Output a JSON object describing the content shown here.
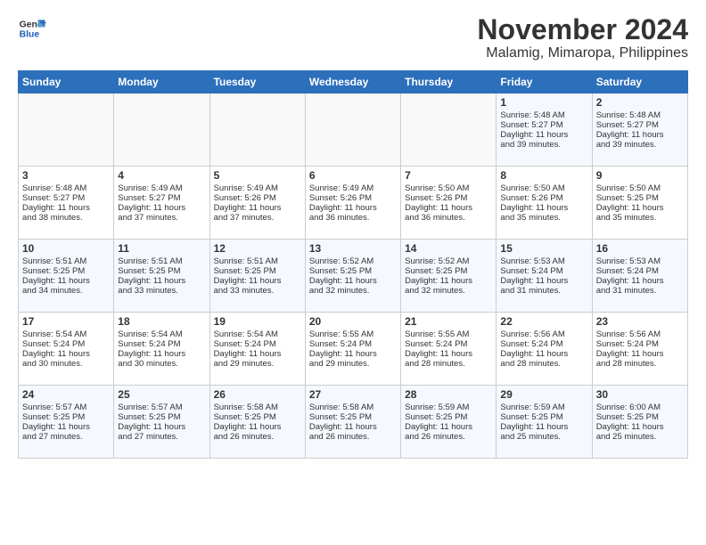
{
  "logo": {
    "line1": "General",
    "line2": "Blue"
  },
  "header": {
    "month": "November 2024",
    "location": "Malamig, Mimaropa, Philippines"
  },
  "weekdays": [
    "Sunday",
    "Monday",
    "Tuesday",
    "Wednesday",
    "Thursday",
    "Friday",
    "Saturday"
  ],
  "weeks": [
    [
      {
        "day": "",
        "info": ""
      },
      {
        "day": "",
        "info": ""
      },
      {
        "day": "",
        "info": ""
      },
      {
        "day": "",
        "info": ""
      },
      {
        "day": "",
        "info": ""
      },
      {
        "day": "1",
        "info": "Sunrise: 5:48 AM\nSunset: 5:27 PM\nDaylight: 11 hours\nand 39 minutes."
      },
      {
        "day": "2",
        "info": "Sunrise: 5:48 AM\nSunset: 5:27 PM\nDaylight: 11 hours\nand 39 minutes."
      }
    ],
    [
      {
        "day": "3",
        "info": "Sunrise: 5:48 AM\nSunset: 5:27 PM\nDaylight: 11 hours\nand 38 minutes."
      },
      {
        "day": "4",
        "info": "Sunrise: 5:49 AM\nSunset: 5:27 PM\nDaylight: 11 hours\nand 37 minutes."
      },
      {
        "day": "5",
        "info": "Sunrise: 5:49 AM\nSunset: 5:26 PM\nDaylight: 11 hours\nand 37 minutes."
      },
      {
        "day": "6",
        "info": "Sunrise: 5:49 AM\nSunset: 5:26 PM\nDaylight: 11 hours\nand 36 minutes."
      },
      {
        "day": "7",
        "info": "Sunrise: 5:50 AM\nSunset: 5:26 PM\nDaylight: 11 hours\nand 36 minutes."
      },
      {
        "day": "8",
        "info": "Sunrise: 5:50 AM\nSunset: 5:26 PM\nDaylight: 11 hours\nand 35 minutes."
      },
      {
        "day": "9",
        "info": "Sunrise: 5:50 AM\nSunset: 5:25 PM\nDaylight: 11 hours\nand 35 minutes."
      }
    ],
    [
      {
        "day": "10",
        "info": "Sunrise: 5:51 AM\nSunset: 5:25 PM\nDaylight: 11 hours\nand 34 minutes."
      },
      {
        "day": "11",
        "info": "Sunrise: 5:51 AM\nSunset: 5:25 PM\nDaylight: 11 hours\nand 33 minutes."
      },
      {
        "day": "12",
        "info": "Sunrise: 5:51 AM\nSunset: 5:25 PM\nDaylight: 11 hours\nand 33 minutes."
      },
      {
        "day": "13",
        "info": "Sunrise: 5:52 AM\nSunset: 5:25 PM\nDaylight: 11 hours\nand 32 minutes."
      },
      {
        "day": "14",
        "info": "Sunrise: 5:52 AM\nSunset: 5:25 PM\nDaylight: 11 hours\nand 32 minutes."
      },
      {
        "day": "15",
        "info": "Sunrise: 5:53 AM\nSunset: 5:24 PM\nDaylight: 11 hours\nand 31 minutes."
      },
      {
        "day": "16",
        "info": "Sunrise: 5:53 AM\nSunset: 5:24 PM\nDaylight: 11 hours\nand 31 minutes."
      }
    ],
    [
      {
        "day": "17",
        "info": "Sunrise: 5:54 AM\nSunset: 5:24 PM\nDaylight: 11 hours\nand 30 minutes."
      },
      {
        "day": "18",
        "info": "Sunrise: 5:54 AM\nSunset: 5:24 PM\nDaylight: 11 hours\nand 30 minutes."
      },
      {
        "day": "19",
        "info": "Sunrise: 5:54 AM\nSunset: 5:24 PM\nDaylight: 11 hours\nand 29 minutes."
      },
      {
        "day": "20",
        "info": "Sunrise: 5:55 AM\nSunset: 5:24 PM\nDaylight: 11 hours\nand 29 minutes."
      },
      {
        "day": "21",
        "info": "Sunrise: 5:55 AM\nSunset: 5:24 PM\nDaylight: 11 hours\nand 28 minutes."
      },
      {
        "day": "22",
        "info": "Sunrise: 5:56 AM\nSunset: 5:24 PM\nDaylight: 11 hours\nand 28 minutes."
      },
      {
        "day": "23",
        "info": "Sunrise: 5:56 AM\nSunset: 5:24 PM\nDaylight: 11 hours\nand 28 minutes."
      }
    ],
    [
      {
        "day": "24",
        "info": "Sunrise: 5:57 AM\nSunset: 5:25 PM\nDaylight: 11 hours\nand 27 minutes."
      },
      {
        "day": "25",
        "info": "Sunrise: 5:57 AM\nSunset: 5:25 PM\nDaylight: 11 hours\nand 27 minutes."
      },
      {
        "day": "26",
        "info": "Sunrise: 5:58 AM\nSunset: 5:25 PM\nDaylight: 11 hours\nand 26 minutes."
      },
      {
        "day": "27",
        "info": "Sunrise: 5:58 AM\nSunset: 5:25 PM\nDaylight: 11 hours\nand 26 minutes."
      },
      {
        "day": "28",
        "info": "Sunrise: 5:59 AM\nSunset: 5:25 PM\nDaylight: 11 hours\nand 26 minutes."
      },
      {
        "day": "29",
        "info": "Sunrise: 5:59 AM\nSunset: 5:25 PM\nDaylight: 11 hours\nand 25 minutes."
      },
      {
        "day": "30",
        "info": "Sunrise: 6:00 AM\nSunset: 5:25 PM\nDaylight: 11 hours\nand 25 minutes."
      }
    ]
  ]
}
